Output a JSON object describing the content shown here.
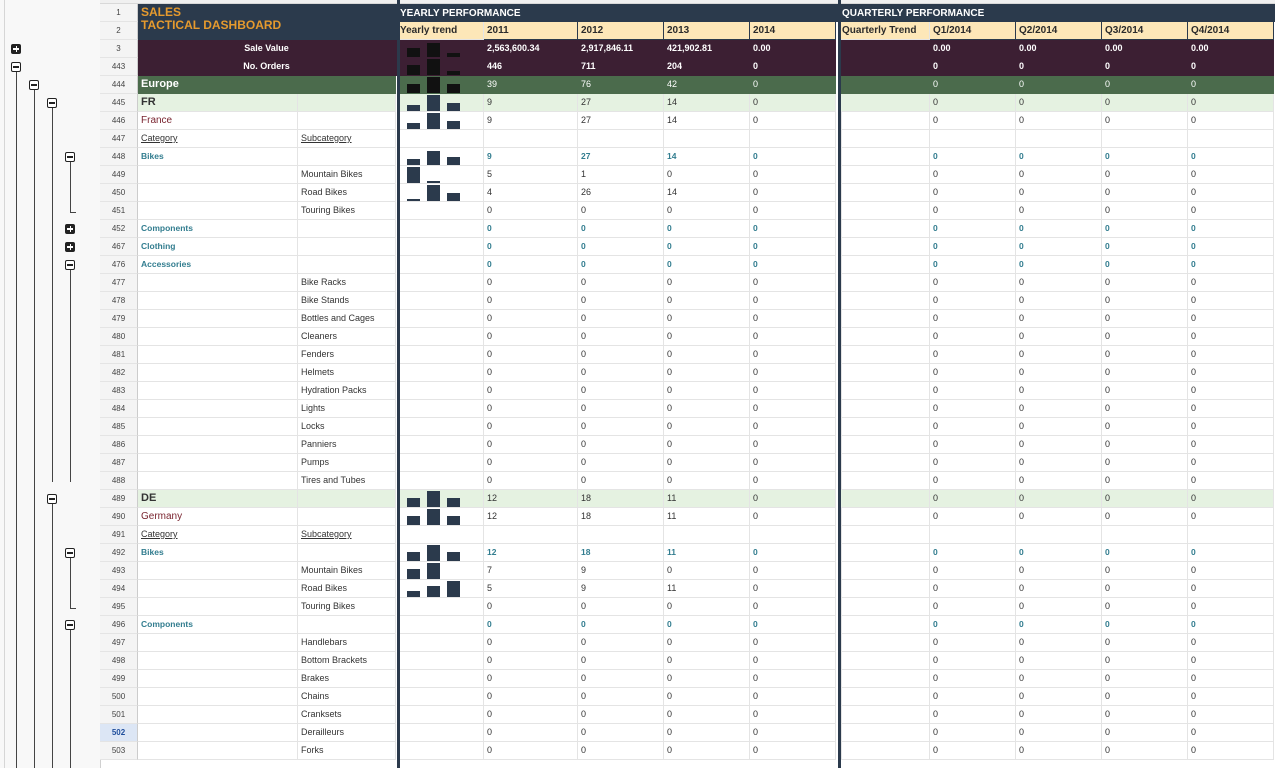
{
  "title": {
    "line1": "SALES",
    "line2": "TACTICAL DASHBOARD"
  },
  "yearly": {
    "header": "YEARLY PERFORMANCE",
    "trend_label": "Yearly trend",
    "years": [
      "2011",
      "2012",
      "2013",
      "2014"
    ]
  },
  "quarterly": {
    "header": "QUARTERLY PERFORMANCE",
    "trend_label": "Quarterly Trend",
    "quarters": [
      "Q1/2014",
      "Q2/2014",
      "Q3/2014",
      "Q4/2014"
    ]
  },
  "summary": {
    "sale_value": {
      "label": "Sale Value",
      "years": [
        "2,563,600.34",
        "2,917,846.11",
        "421,902.81",
        "0.00"
      ],
      "quarters": [
        "0.00",
        "0.00",
        "0.00",
        "0.00"
      ]
    },
    "orders": {
      "label": "No. Orders",
      "years": [
        "446",
        "711",
        "204",
        "0"
      ],
      "quarters": [
        "0",
        "0",
        "0",
        "0"
      ]
    }
  },
  "colors": {
    "navy": "#2b3a4c",
    "plum": "#3c1f33",
    "green": "#4b6b4c",
    "light_green": "#e5f2e1",
    "orange": "#e59a2e",
    "blue": "#327d8f",
    "red": "#7a2530",
    "yellow": "#fde7b8"
  },
  "selected_row": "502",
  "rows": [
    {
      "n": "1",
      "type": "title1"
    },
    {
      "n": "2",
      "type": "title2"
    },
    {
      "n": "3",
      "type": "summary",
      "key": "sale_value",
      "bars": [
        [
          0.55,
          0.06
        ],
        [
          0.9,
          0.2
        ],
        [
          0.25,
          0.05
        ]
      ]
    },
    {
      "n": "443",
      "type": "summary",
      "key": "orders",
      "bars": [
        [
          0.6,
          0.1
        ],
        [
          1.0,
          0.3
        ],
        [
          0.25,
          0.05
        ]
      ]
    },
    {
      "n": "444",
      "type": "region",
      "a": "Europe",
      "vals": [
        "39",
        "76",
        "42",
        "0"
      ],
      "bars": [
        [
          0.55,
          0.1
        ],
        [
          1.0,
          0.0
        ],
        [
          0.55,
          0.1
        ]
      ]
    },
    {
      "n": "445",
      "type": "country",
      "a": "FR",
      "vals": [
        "9",
        "27",
        "14",
        "0"
      ],
      "bars": [
        [
          0.35,
          0.2
        ],
        [
          1.0,
          0.0
        ],
        [
          0.5,
          0.2
        ]
      ]
    },
    {
      "n": "446",
      "type": "countryname",
      "a": "France",
      "vals": [
        "9",
        "27",
        "14",
        "0"
      ],
      "bars": [
        [
          0.35,
          0.2
        ],
        [
          1.0,
          0.0
        ],
        [
          0.5,
          0.2
        ]
      ]
    },
    {
      "n": "447",
      "type": "catheader",
      "a": "Category",
      "b": "Subcategory"
    },
    {
      "n": "448",
      "type": "cat",
      "a": "Bikes",
      "vals": [
        "9",
        "27",
        "14",
        "0"
      ],
      "bars": [
        [
          0.35,
          0.0
        ],
        [
          0.9,
          0.0
        ],
        [
          0.5,
          0.0
        ]
      ]
    },
    {
      "n": "449",
      "type": "sub",
      "b": "Mountain Bikes",
      "vals": [
        "5",
        "1",
        "0",
        "0"
      ],
      "bars": [
        [
          1.0,
          0.0
        ],
        [
          0.15,
          0.0
        ],
        [
          0.0,
          0.0
        ]
      ]
    },
    {
      "n": "450",
      "type": "sub",
      "b": "Road Bikes",
      "vals": [
        "4",
        "26",
        "14",
        "0"
      ],
      "bars": [
        [
          0.15,
          0.0
        ],
        [
          1.0,
          0.0
        ],
        [
          0.5,
          0.0
        ]
      ]
    },
    {
      "n": "451",
      "type": "sub",
      "b": "Touring Bikes",
      "vals": [
        "0",
        "0",
        "0",
        "0"
      ]
    },
    {
      "n": "452",
      "type": "cat",
      "a": "Components",
      "vals": [
        "0",
        "0",
        "0",
        "0"
      ]
    },
    {
      "n": "467",
      "type": "cat",
      "a": "Clothing",
      "vals": [
        "0",
        "0",
        "0",
        "0"
      ]
    },
    {
      "n": "476",
      "type": "cat",
      "a": "Accessories",
      "vals": [
        "0",
        "0",
        "0",
        "0"
      ]
    },
    {
      "n": "477",
      "type": "sub",
      "b": "Bike Racks",
      "vals": [
        "0",
        "0",
        "0",
        "0"
      ]
    },
    {
      "n": "478",
      "type": "sub",
      "b": "Bike Stands",
      "vals": [
        "0",
        "0",
        "0",
        "0"
      ]
    },
    {
      "n": "479",
      "type": "sub",
      "b": "Bottles and Cages",
      "vals": [
        "0",
        "0",
        "0",
        "0"
      ]
    },
    {
      "n": "480",
      "type": "sub",
      "b": "Cleaners",
      "vals": [
        "0",
        "0",
        "0",
        "0"
      ]
    },
    {
      "n": "481",
      "type": "sub",
      "b": "Fenders",
      "vals": [
        "0",
        "0",
        "0",
        "0"
      ]
    },
    {
      "n": "482",
      "type": "sub",
      "b": "Helmets",
      "vals": [
        "0",
        "0",
        "0",
        "0"
      ]
    },
    {
      "n": "483",
      "type": "sub",
      "b": "Hydration Packs",
      "vals": [
        "0",
        "0",
        "0",
        "0"
      ]
    },
    {
      "n": "484",
      "type": "sub",
      "b": "Lights",
      "vals": [
        "0",
        "0",
        "0",
        "0"
      ]
    },
    {
      "n": "485",
      "type": "sub",
      "b": "Locks",
      "vals": [
        "0",
        "0",
        "0",
        "0"
      ]
    },
    {
      "n": "486",
      "type": "sub",
      "b": "Panniers",
      "vals": [
        "0",
        "0",
        "0",
        "0"
      ]
    },
    {
      "n": "487",
      "type": "sub",
      "b": "Pumps",
      "vals": [
        "0",
        "0",
        "0",
        "0"
      ]
    },
    {
      "n": "488",
      "type": "sub",
      "b": "Tires and Tubes",
      "vals": [
        "0",
        "0",
        "0",
        "0"
      ]
    },
    {
      "n": "489",
      "type": "country",
      "a": "DE",
      "vals": [
        "12",
        "18",
        "11",
        "0"
      ],
      "bars": [
        [
          0.55,
          0.1
        ],
        [
          1.0,
          0.0
        ],
        [
          0.55,
          0.1
        ]
      ]
    },
    {
      "n": "490",
      "type": "countryname",
      "a": "Germany",
      "vals": [
        "12",
        "18",
        "11",
        "0"
      ],
      "bars": [
        [
          0.55,
          0.1
        ],
        [
          1.0,
          0.0
        ],
        [
          0.55,
          0.1
        ]
      ]
    },
    {
      "n": "491",
      "type": "catheader",
      "a": "Category",
      "b": "Subcategory"
    },
    {
      "n": "492",
      "type": "cat",
      "a": "Bikes",
      "vals": [
        "12",
        "18",
        "11",
        "0"
      ],
      "bars": [
        [
          0.55,
          0.0
        ],
        [
          1.0,
          0.0
        ],
        [
          0.55,
          0.0
        ]
      ]
    },
    {
      "n": "493",
      "type": "sub",
      "b": "Mountain Bikes",
      "vals": [
        "7",
        "9",
        "0",
        "0"
      ],
      "bars": [
        [
          0.6,
          0.0
        ],
        [
          1.0,
          0.0
        ],
        [
          0.0,
          0.0
        ]
      ]
    },
    {
      "n": "494",
      "type": "sub",
      "b": "Road Bikes",
      "vals": [
        "5",
        "9",
        "11",
        "0"
      ],
      "bars": [
        [
          0.4,
          0.0
        ],
        [
          0.7,
          0.0
        ],
        [
          1.0,
          0.0
        ]
      ]
    },
    {
      "n": "495",
      "type": "sub",
      "b": "Touring Bikes",
      "vals": [
        "0",
        "0",
        "0",
        "0"
      ]
    },
    {
      "n": "496",
      "type": "cat",
      "a": "Components",
      "vals": [
        "0",
        "0",
        "0",
        "0"
      ]
    },
    {
      "n": "497",
      "type": "sub",
      "b": "Handlebars",
      "vals": [
        "0",
        "0",
        "0",
        "0"
      ]
    },
    {
      "n": "498",
      "type": "sub",
      "b": "Bottom Brackets",
      "vals": [
        "0",
        "0",
        "0",
        "0"
      ]
    },
    {
      "n": "499",
      "type": "sub",
      "b": "Brakes",
      "vals": [
        "0",
        "0",
        "0",
        "0"
      ]
    },
    {
      "n": "500",
      "type": "sub",
      "b": "Chains",
      "vals": [
        "0",
        "0",
        "0",
        "0"
      ]
    },
    {
      "n": "501",
      "type": "sub",
      "b": "Cranksets",
      "vals": [
        "0",
        "0",
        "0",
        "0"
      ]
    },
    {
      "n": "502",
      "type": "sub",
      "b": "Derailleurs",
      "vals": [
        "0",
        "0",
        "0",
        "0"
      ]
    },
    {
      "n": "503",
      "type": "sub",
      "b": "Forks",
      "vals": [
        "0",
        "0",
        "0",
        "0"
      ]
    }
  ],
  "outline": [
    {
      "row": "3",
      "kind": "plus",
      "level": 0
    },
    {
      "row": "443",
      "kind": "minus",
      "level": 0
    },
    {
      "row": "444",
      "kind": "minus",
      "level": 1
    },
    {
      "row": "445",
      "kind": "minus",
      "level": 2
    },
    {
      "row": "448",
      "kind": "minus",
      "level": 3
    },
    {
      "row": "452",
      "kind": "plus",
      "level": 3
    },
    {
      "row": "467",
      "kind": "plus",
      "level": 3
    },
    {
      "row": "476",
      "kind": "minus",
      "level": 3
    },
    {
      "row": "489",
      "kind": "minus",
      "level": 2
    },
    {
      "row": "492",
      "kind": "minus",
      "level": 3
    },
    {
      "row": "496",
      "kind": "minus",
      "level": 3
    }
  ]
}
